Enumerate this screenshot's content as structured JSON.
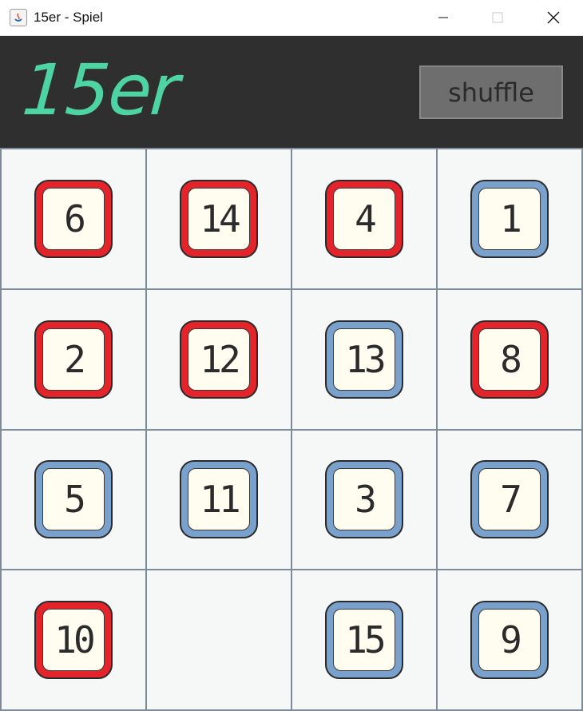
{
  "window": {
    "title": "15er - Spiel"
  },
  "header": {
    "logo": "15er",
    "shuffle_label": "shuffle"
  },
  "board": {
    "tiles": [
      {
        "number": "6",
        "color": "red"
      },
      {
        "number": "14",
        "color": "red"
      },
      {
        "number": "4",
        "color": "red"
      },
      {
        "number": "1",
        "color": "blue"
      },
      {
        "number": "2",
        "color": "red"
      },
      {
        "number": "12",
        "color": "red"
      },
      {
        "number": "13",
        "color": "blue"
      },
      {
        "number": "8",
        "color": "red"
      },
      {
        "number": "5",
        "color": "blue"
      },
      {
        "number": "11",
        "color": "blue"
      },
      {
        "number": "3",
        "color": "blue"
      },
      {
        "number": "7",
        "color": "blue"
      },
      {
        "number": "10",
        "color": "red"
      },
      null,
      {
        "number": "15",
        "color": "blue"
      },
      {
        "number": "9",
        "color": "blue"
      }
    ]
  },
  "colors": {
    "logo": "#4ed3a4",
    "header_bg": "#2f2f2f",
    "tile_red": "#e3242b",
    "tile_blue": "#7aa0cc"
  }
}
